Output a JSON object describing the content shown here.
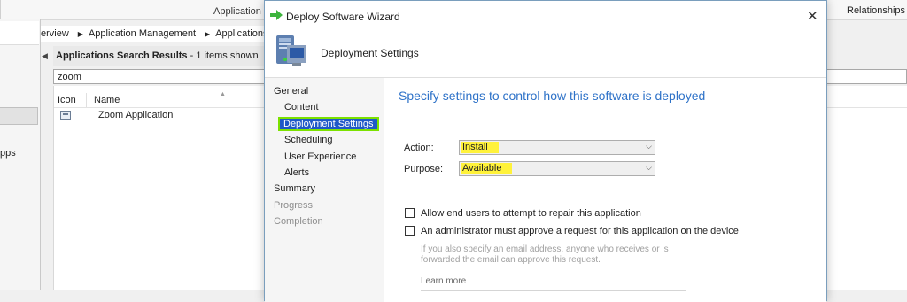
{
  "console": {
    "ribbon": {
      "application_group": "Application",
      "relationships_group": "Relationships"
    },
    "left_nav": {
      "apps_label": "pps"
    },
    "breadcrumb": [
      "erview",
      "Application Management",
      "Applications"
    ],
    "results": {
      "title": "Applications Search Results",
      "separator": "-",
      "count_text": "1 items shown"
    },
    "search_value": "zoom",
    "columns": {
      "icon": "Icon",
      "name": "Name"
    },
    "rows": [
      {
        "name": "Zoom Application"
      }
    ]
  },
  "dialog": {
    "title": "Deploy Software Wizard",
    "close_glyph": "✕",
    "page_heading": "Deployment Settings",
    "nav": {
      "general": "General",
      "content": "Content",
      "deployment_settings": "Deployment Settings",
      "scheduling": "Scheduling",
      "user_experience": "User Experience",
      "alerts": "Alerts",
      "summary": "Summary",
      "progress": "Progress",
      "completion": "Completion"
    },
    "content": {
      "heading": "Specify settings to control how this software is deployed",
      "action_label": "Action:",
      "action_value": "Install",
      "purpose_label": "Purpose:",
      "purpose_value": "Available",
      "repair_label": "Allow end users to attempt to repair this application",
      "approve_label": "An administrator must approve a request for this application on the device",
      "email_note": "If you also specify an email address, anyone who receives or is forwarded the email can approve this request.",
      "learn_more": "Learn more"
    }
  },
  "colors": {
    "heading_blue": "#2e72c8",
    "highlight": "#fff23a",
    "active_nav": "#1f58c8",
    "active_outline": "#7ce100"
  },
  "icons": {
    "title_icon": "green-arrow-icon",
    "header_icon": "computer-tower-icon",
    "row_icon": "application-icon"
  }
}
